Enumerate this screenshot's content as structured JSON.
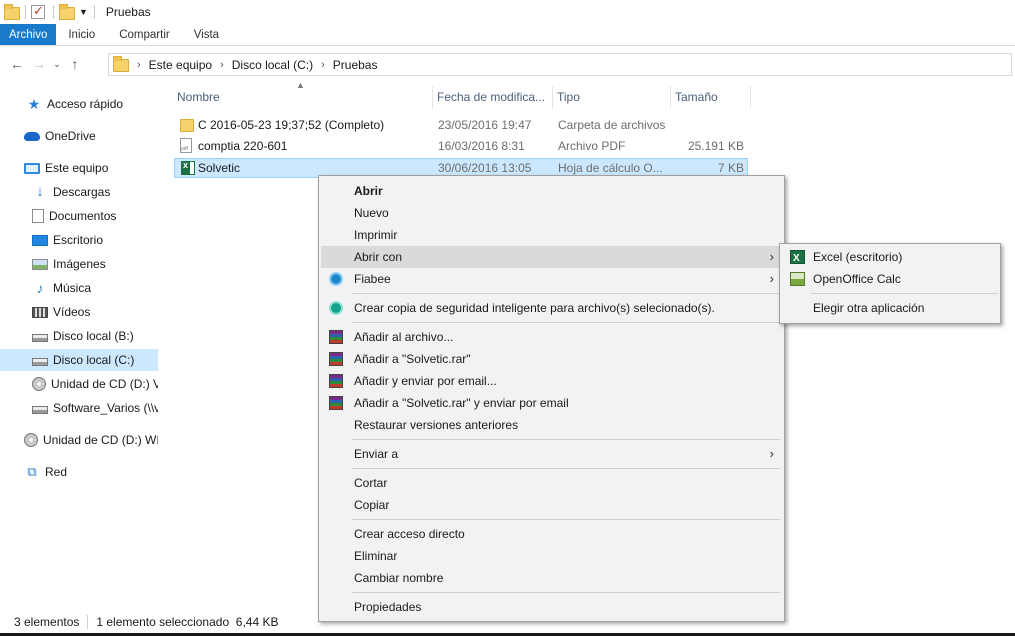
{
  "window": {
    "title": "Pruebas"
  },
  "ribbon": {
    "tabs": [
      "Archivo",
      "Inicio",
      "Compartir",
      "Vista"
    ],
    "active": "Archivo"
  },
  "address": {
    "crumbs": [
      "Este equipo",
      "Disco local (C:)",
      "Pruebas"
    ]
  },
  "sidebar": {
    "items": [
      {
        "label": "Acceso rápido",
        "icon": "star-icon"
      },
      {
        "label": "OneDrive",
        "icon": "cloud-icon"
      },
      {
        "label": "Este equipo",
        "icon": "computer-icon"
      },
      {
        "label": "Descargas",
        "icon": "download-icon"
      },
      {
        "label": "Documentos",
        "icon": "document-icon"
      },
      {
        "label": "Escritorio",
        "icon": "desktop-icon"
      },
      {
        "label": "Imágenes",
        "icon": "pictures-icon"
      },
      {
        "label": "Música",
        "icon": "music-icon"
      },
      {
        "label": "Vídeos",
        "icon": "video-icon"
      },
      {
        "label": "Disco local (B:)",
        "icon": "drive-icon"
      },
      {
        "label": "Disco local (C:)",
        "icon": "drive-icon",
        "selected": true
      },
      {
        "label": "Unidad de CD (D:) V",
        "icon": "cd-drive-icon"
      },
      {
        "label": "Software_Varios (\\\\v",
        "icon": "network-drive-icon"
      },
      {
        "label": "Unidad de CD (D:) WI",
        "icon": "cd-drive-icon"
      },
      {
        "label": "Red",
        "icon": "network-icon"
      }
    ]
  },
  "filelist": {
    "columns": [
      "Nombre",
      "Fecha de modifica...",
      "Tipo",
      "Tamaño"
    ],
    "rows": [
      {
        "name": "C 2016-05-23 19;37;52 (Completo)",
        "date": "23/05/2016 19:47",
        "type": "Carpeta de archivos",
        "size": "",
        "icon": "folder-icon"
      },
      {
        "name": "comptia 220-601",
        "date": "16/03/2016 8:31",
        "type": "Archivo PDF",
        "size": "25.191 KB",
        "icon": "pdf-file-icon"
      },
      {
        "name": "Solvetic",
        "date": "30/06/2016 13:05",
        "type": "Hoja de cálculo O...",
        "size": "7 KB",
        "icon": "spreadsheet-file-icon",
        "selected": true
      }
    ]
  },
  "status": {
    "count": "3 elementos",
    "selection": "1 elemento seleccionado  6,44 KB"
  },
  "context_menu": {
    "items": {
      "abrir": "Abrir",
      "nuevo": "Nuevo",
      "imprimir": "Imprimir",
      "abrir_con": "Abrir con",
      "fiabee": "Fiabee",
      "backup": "Crear copia de seguridad inteligente para archivo(s) selecionado(s).",
      "anadir_archivo": "Añadir al archivo...",
      "anadir_rar": "Añadir a \"Solvetic.rar\"",
      "anadir_email": "Añadir y enviar por email...",
      "anadir_rar_email": "Añadir a \"Solvetic.rar\" y enviar por email",
      "restaurar": "Restaurar versiones anteriores",
      "enviar_a": "Enviar a",
      "cortar": "Cortar",
      "copiar": "Copiar",
      "acceso_directo": "Crear acceso directo",
      "eliminar": "Eliminar",
      "cambiar_nombre": "Cambiar nombre",
      "propiedades": "Propiedades"
    }
  },
  "submenu": {
    "excel": "Excel (escritorio)",
    "calc": "OpenOffice Calc",
    "otra": "Elegir otra aplicación"
  },
  "colors": {
    "accent": "#1979ca",
    "selection": "#cce8ff",
    "menu_bg": "#f2f2f2",
    "menu_hover": "#dadada"
  }
}
